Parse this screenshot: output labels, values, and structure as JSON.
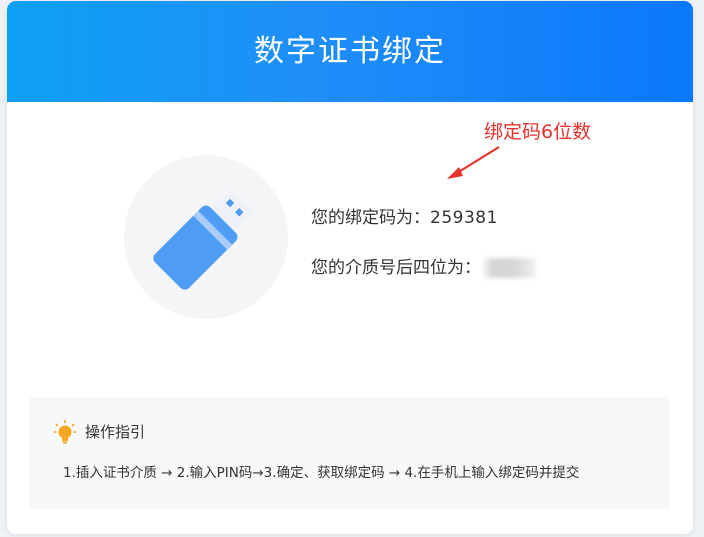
{
  "dialog": {
    "title": "数字证书绑定"
  },
  "annotation": {
    "text": "绑定码6位数",
    "color": "#e8322c"
  },
  "icons": {
    "device": "usb-key-icon",
    "tip": "lightbulb-icon"
  },
  "info": {
    "bind_code_label": "您的绑定码为：",
    "bind_code_value": "259381",
    "medium_label": "您的介质号后四位为：",
    "medium_value": ""
  },
  "guide": {
    "title": "操作指引",
    "steps": "1.插入证书介质 → 2.输入PIN码→3.确定、获取绑定码 → 4.在手机上输入绑定码并提交"
  },
  "colors": {
    "header_start": "#0ea0f2",
    "header_end": "#0a78fb",
    "usb_body": "#4f9cf5",
    "usb_stripe": "#a9ccfa",
    "usb_cap": "#eef2f8",
    "bulb": "#f5a623"
  }
}
